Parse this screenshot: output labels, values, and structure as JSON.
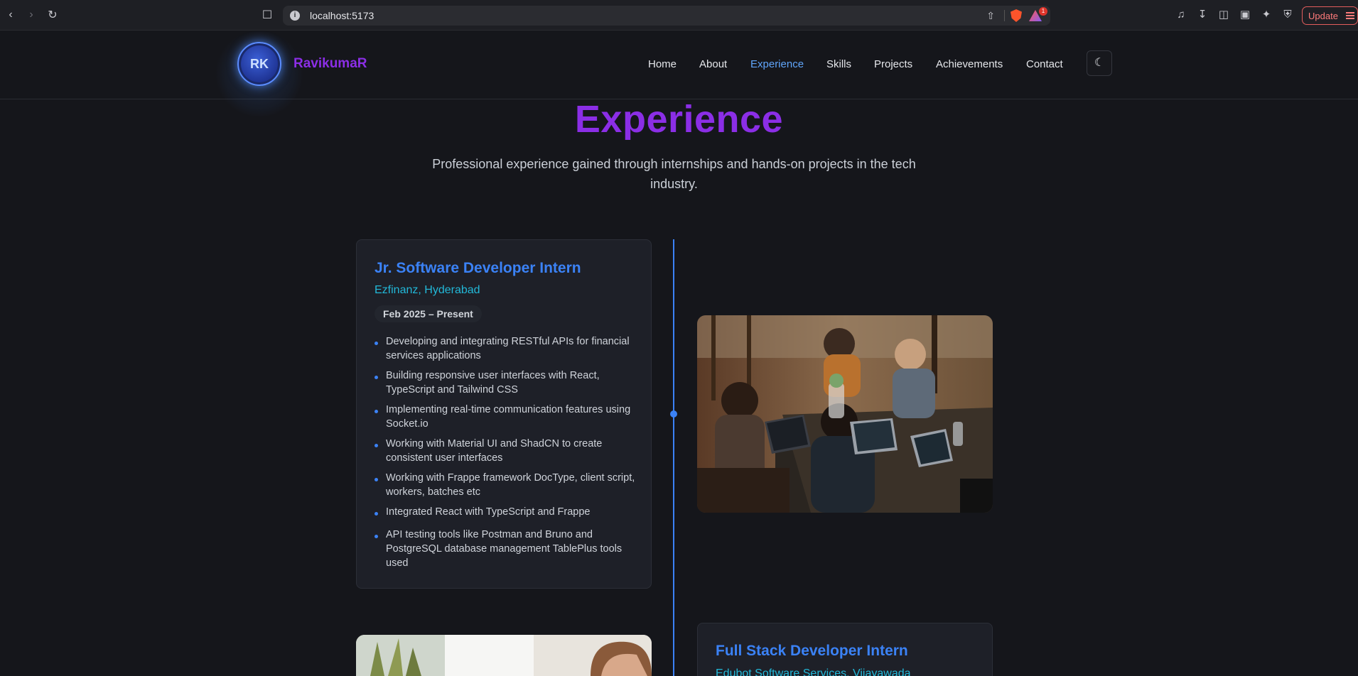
{
  "browser": {
    "url": "localhost:5173",
    "update_label": "Update",
    "rewards_count": "1"
  },
  "header": {
    "logo_initials": "RK",
    "logo_name": "RavikumaR",
    "nav": [
      {
        "label": "Home"
      },
      {
        "label": "About"
      },
      {
        "label": "Experience",
        "active": true
      },
      {
        "label": "Skills"
      },
      {
        "label": "Projects"
      },
      {
        "label": "Achievements"
      },
      {
        "label": "Contact"
      }
    ],
    "theme_icon": "moon-icon"
  },
  "section": {
    "title": "Experience",
    "subtitle": "Professional experience gained through internships and hands-on projects in the tech industry."
  },
  "experiences": [
    {
      "title": "Jr. Software Developer Intern",
      "company": "Ezfinanz, Hyderabad",
      "date": "Feb 2025 – Present",
      "bullets": [
        "Developing and integrating RESTful APIs for financial services applications",
        "Building responsive user interfaces with React, TypeScript and Tailwind CSS",
        "Implementing real-time communication features using Socket.io",
        "Working with Material UI and ShadCN to create consistent user interfaces",
        "Working with Frappe framework DocType, client script, workers, batches etc",
        "Integrated React with TypeScript and Frappe",
        "API testing tools like Postman and Bruno and PostgreSQL database management TablePlus tools used"
      ]
    },
    {
      "title": "Full Stack Developer Intern",
      "company": "Edubot Software Services, Vijayawada"
    }
  ],
  "colors": {
    "accent_purple": "#8b2ee6",
    "accent_blue": "#3b82f6",
    "accent_cyan": "#22b8d8",
    "background": "#15161b"
  }
}
